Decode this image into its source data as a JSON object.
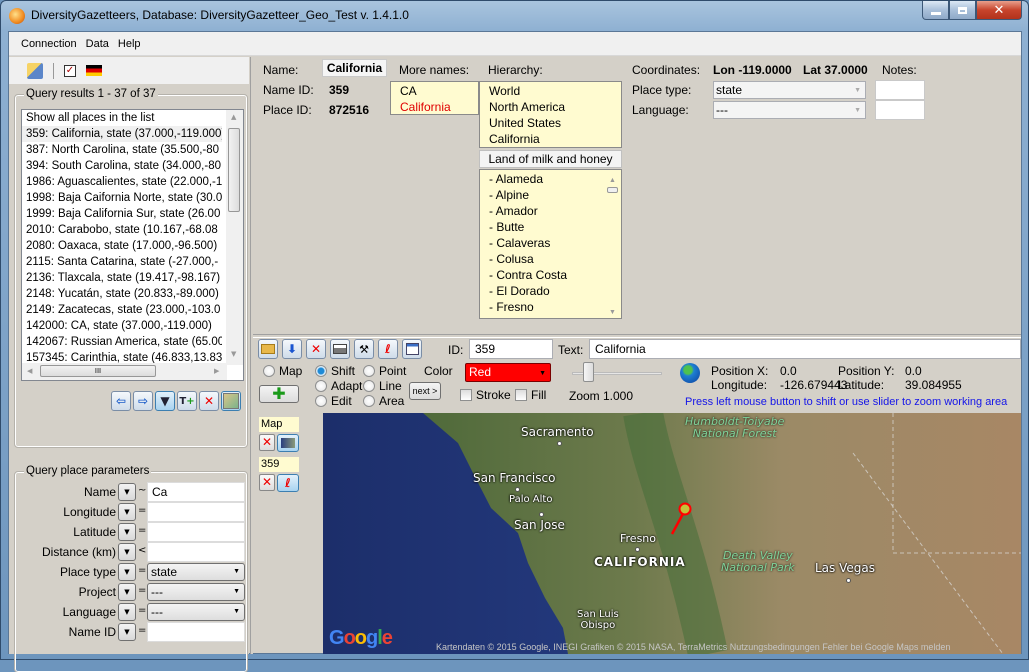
{
  "window": {
    "title": "DiversityGazetteers,  Database: DiversityGazetteer_Geo_Test  v. 1.4.1.0",
    "controls": {
      "minimize": "—",
      "maximize": "□",
      "close": "✕"
    }
  },
  "menu": [
    "Connection",
    "Data",
    "Help"
  ],
  "left_toolbar": {
    "icons": [
      "database-icon",
      "checkbox-icon",
      "german-flag-icon"
    ]
  },
  "query_results": {
    "title": "Query results  1 - 37 of 37",
    "items": [
      "Show all places in the list",
      "359: California, state (37.000,-119.000)",
      "387: North Carolina, state (35.500,-80",
      "394: South Carolina, state (34.000,-80",
      "1986: Aguascalientes, state (22.000,-102",
      "1998: Baja Caifornia Norte, state (30.0",
      "1999: Baja California Sur, state (26.00",
      "2010: Carabobo, state (10.167,-68.08",
      "2080: Oaxaca, state (17.000,-96.500)",
      "2115: Santa Catarina, state (-27.000,-",
      "2136: Tlaxcala, state (19.417,-98.167)",
      "2148: Yucatán, state (20.833,-89.000)",
      "2149: Zacatecas, state (23.000,-103.0",
      "142000: CA, state (37.000,-119.000)",
      "142067: Russian America, state (65.00",
      "157345: Carinthia, state (46.833,13.83"
    ],
    "selected_index": 1,
    "hscroll_grip": "III"
  },
  "query_params": {
    "title": "Query place parameters",
    "rows": [
      {
        "label": "Name",
        "op": "~",
        "value": "Ca",
        "kind": "text"
      },
      {
        "label": "Longitude",
        "op": "=",
        "value": "",
        "kind": "text"
      },
      {
        "label": "Latitude",
        "op": "=",
        "value": "",
        "kind": "text"
      },
      {
        "label": "Distance (km)",
        "op": "<",
        "value": "",
        "kind": "text"
      },
      {
        "label": "Place type",
        "op": "=",
        "value": "state",
        "kind": "select"
      },
      {
        "label": "Project",
        "op": "=",
        "value": "---",
        "kind": "select"
      },
      {
        "label": "Language",
        "op": "=",
        "value": "---",
        "kind": "select"
      },
      {
        "label": "Name ID",
        "op": "=",
        "value": "",
        "kind": "text"
      }
    ]
  },
  "details": {
    "name_label": "Name:",
    "name_value": "California",
    "name_id_label": "Name ID:",
    "name_id_value": "359",
    "place_id_label": "Place ID:",
    "place_id_value": "872516",
    "more_names_label": "More names:",
    "more_names": [
      "CA",
      "California"
    ],
    "hierarchy_label": "Hierarchy:",
    "hierarchy": [
      "World",
      "North America",
      "United States",
      "California"
    ],
    "description": "Land of milk and honey",
    "children": [
      "- Alameda",
      "- Alpine",
      "- Amador",
      "- Butte",
      "- Calaveras",
      "- Colusa",
      "- Contra Costa",
      "- El Dorado",
      "- Fresno"
    ],
    "coordinates_label": "Coordinates:",
    "lon": "Lon -119.0000",
    "lat": "Lat 37.0000",
    "notes_label": "Notes:",
    "place_type_label": "Place type:",
    "place_type_value": "state",
    "language_label": "Language:",
    "language_value": "---"
  },
  "map_panel": {
    "id_label": "ID:",
    "id_value": "359",
    "text_label": "Text:",
    "text_value": "California",
    "modes": {
      "map": "Map",
      "shift": "Shift",
      "adapt": "Adapt",
      "edit": "Edit",
      "point": "Point",
      "line": "Line",
      "area": "Area"
    },
    "selected_mode": "Shift",
    "color_label": "Color",
    "color_value": "Red",
    "next_label": "next >",
    "stroke_label": "Stroke",
    "fill_label": "Fill",
    "zoom_label": "Zoom",
    "zoom_value": "1.000",
    "position_x_label": "Position X:",
    "position_x": "0.0",
    "position_y_label": "Position Y:",
    "position_y": "0.0",
    "longitude_label": "Longitude:",
    "longitude": "-126.679443",
    "latitude_label": "Latitude:",
    "latitude": "39.084955",
    "hint": "Press left mouse button to shift or use slider to zoom working area",
    "layers": [
      {
        "label": "Map"
      },
      {
        "label": "359"
      }
    ]
  },
  "map": {
    "labels": {
      "sacramento": "Sacramento",
      "san_francisco": "San Francisco",
      "palo_alto": "Palo Alto",
      "san_jose": "San Jose",
      "fresno": "Fresno",
      "california": "CALIFORNIA",
      "san_luis_obispo": "San Luis\nObispo",
      "humboldt": "Humboldt-Toiyabe\nNational Forest",
      "death_valley": "Death Valley\nNational Park",
      "las_vegas": "Las Vegas"
    },
    "logo": "Google",
    "attribution": "Kartendaten © 2015 Google, INEGI Grafiken © 2015 NASA, TerraMetrics   Nutzungsbedingungen   Fehler bei Google Maps melden",
    "marker_color": "#ff0000"
  }
}
